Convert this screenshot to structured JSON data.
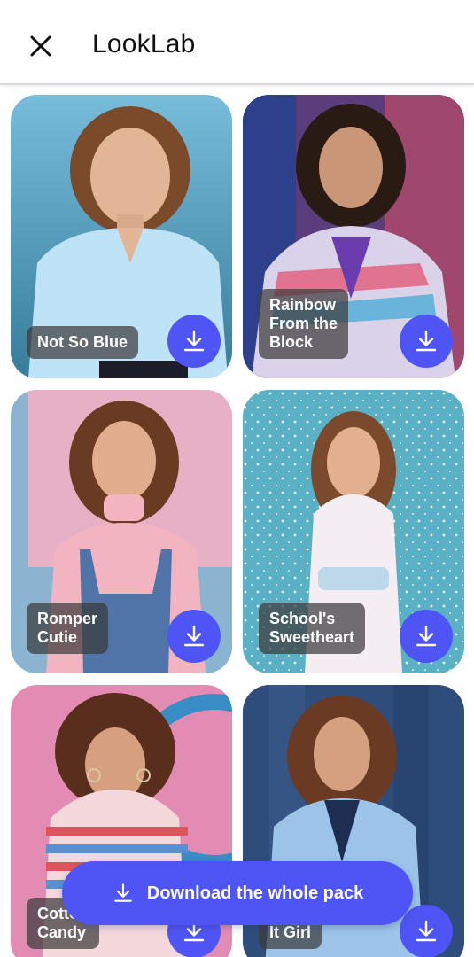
{
  "header": {
    "title": "LookLab",
    "close_icon": "close-icon"
  },
  "cards": [
    {
      "label": "Not So Blue",
      "bg": "#4aa6cf",
      "outfit": "#bfe3f6",
      "hair": "#7a4a2a",
      "icon": "download-icon"
    },
    {
      "label": "Rainbow\nFrom the\nBlock",
      "bg": "#5a3d7a",
      "outfit": "#d9d2e8",
      "hair": "#2a1a14",
      "icon": "download-icon"
    },
    {
      "label": "Romper\nCutie",
      "bg": "#e8b0c4",
      "outfit": "#4e74a8",
      "hair": "#6b3a22",
      "icon": "download-icon"
    },
    {
      "label": "School's\nSweetheart",
      "bg": "#5ab0c4",
      "outfit": "#f4eef2",
      "hair": "#7b4a2c",
      "icon": "download-icon"
    },
    {
      "label": "Cotton\nCandy",
      "bg": "#e28cb4",
      "outfit": "#f3d8dc",
      "hair": "#5a2e1c",
      "icon": "download-icon"
    },
    {
      "label": "It Girl",
      "bg": "#2f4d7a",
      "outfit": "#9cc4e8",
      "hair": "#6a3a22",
      "icon": "download-icon"
    }
  ],
  "pack_button": {
    "label": "Download the whole pack",
    "icon": "download-icon"
  },
  "colors": {
    "accent": "#4f55f5",
    "label_bg": "#3c3c3c"
  }
}
